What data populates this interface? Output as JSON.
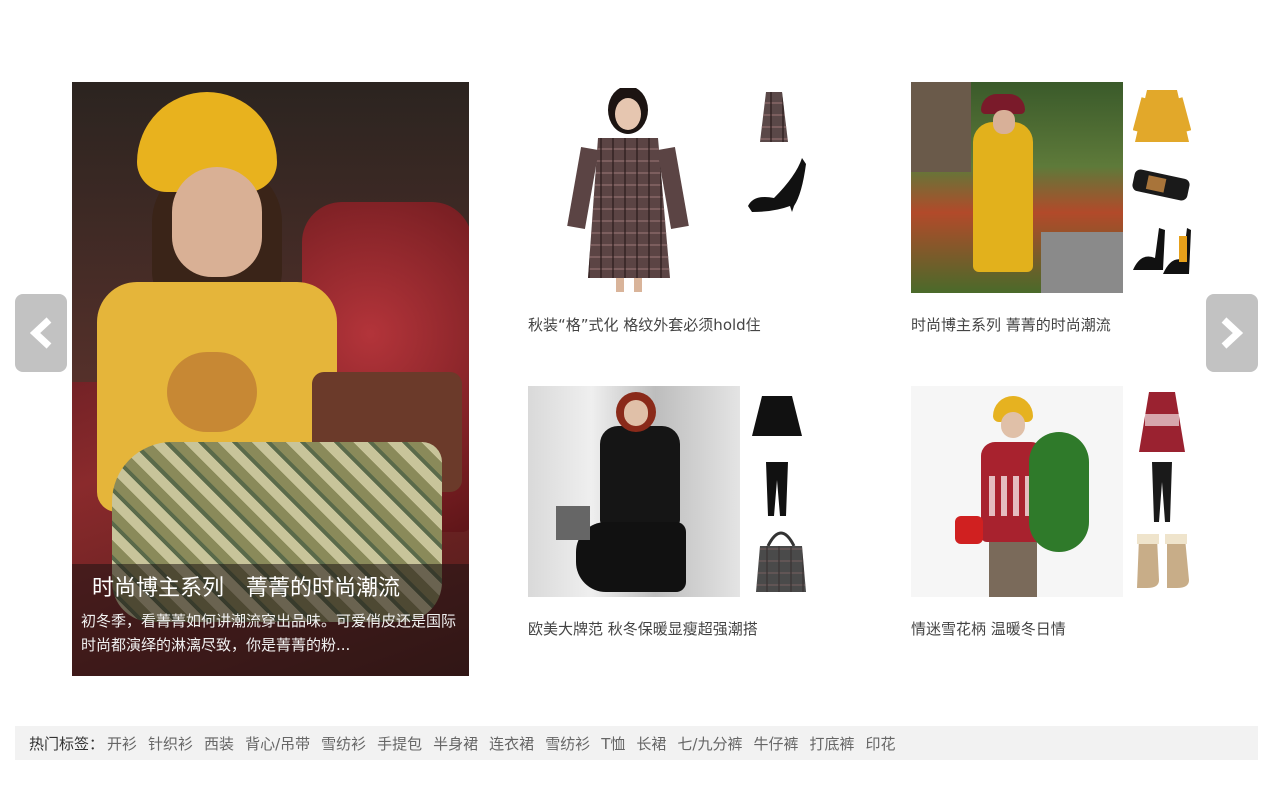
{
  "hero": {
    "title": "时尚博主系列　菁菁的时尚潮流",
    "description": "初冬季，看菁菁如何讲潮流穿出品味。可爱俏皮还是国际时尚都演绎的淋漓尽致，你是菁菁的粉..."
  },
  "cards": [
    {
      "title": "秋装“格”式化 格纹外套必须hold住"
    },
    {
      "title": "时尚博主系列 菁菁的时尚潮流"
    },
    {
      "title": "欧美大牌范 秋冬保暖显瘦超强潮搭"
    },
    {
      "title": "情迷雪花柄 温暖冬日情"
    }
  ],
  "tags": {
    "label": "热门标签：",
    "items": [
      "开衫",
      "针织衫",
      "西装",
      "背心/吊带",
      "雪纺衫",
      "手提包",
      "半身裙",
      "连衣裙",
      "雪纺衫",
      "T恤",
      "长裙",
      "七/九分裤",
      "牛仔裤",
      "打底裤",
      "印花"
    ]
  },
  "colors": {
    "arrow_bg": "#c2c2c2",
    "tag_bar": "#f2f2f2"
  },
  "icons": {
    "prev": "chevron-left-icon",
    "next": "chevron-right-icon"
  }
}
